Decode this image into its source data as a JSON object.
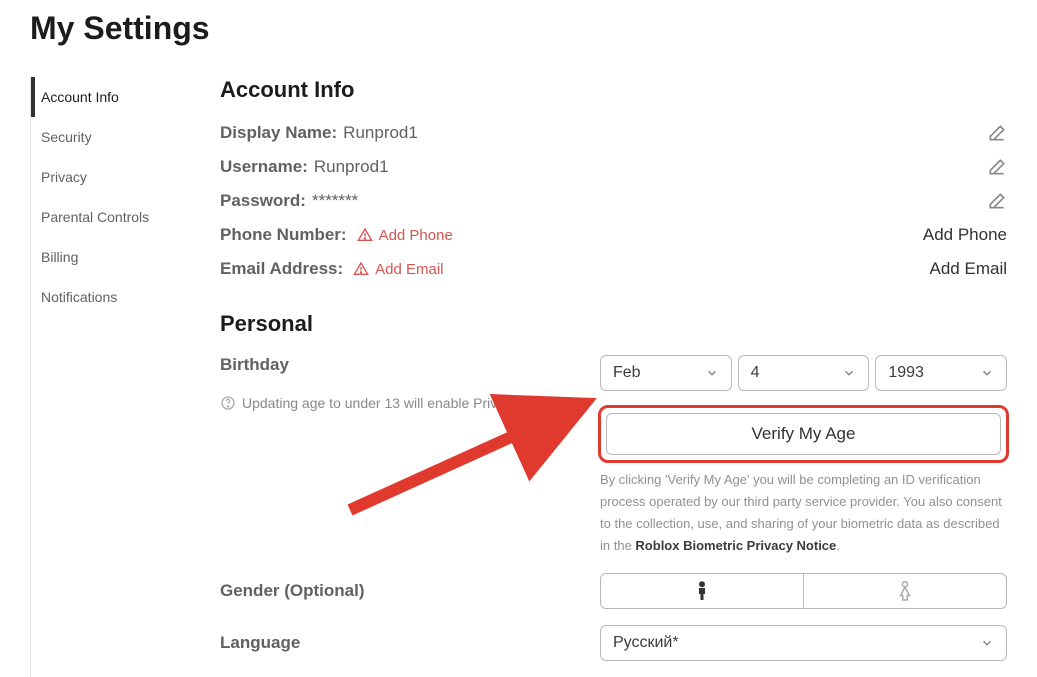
{
  "page_title": "My Settings",
  "sidebar": {
    "items": [
      {
        "label": "Account Info",
        "active": true
      },
      {
        "label": "Security",
        "active": false
      },
      {
        "label": "Privacy",
        "active": false
      },
      {
        "label": "Parental Controls",
        "active": false
      },
      {
        "label": "Billing",
        "active": false
      },
      {
        "label": "Notifications",
        "active": false
      }
    ]
  },
  "account_info": {
    "heading": "Account Info",
    "display_name_label": "Display Name:",
    "display_name_value": "Runprod1",
    "username_label": "Username:",
    "username_value": "Runprod1",
    "password_label": "Password:",
    "password_value": "*******",
    "phone_label": "Phone Number:",
    "phone_add_link": "Add Phone",
    "phone_action": "Add Phone",
    "email_label": "Email Address:",
    "email_add_link": "Add Email",
    "email_action": "Add Email"
  },
  "personal": {
    "heading": "Personal",
    "birthday_label": "Birthday",
    "birthday_month": "Feb",
    "birthday_day": "4",
    "birthday_year": "1993",
    "age_hint": "Updating age to under 13 will enable Privacy Mode.",
    "verify_button": "Verify My Age",
    "disclaimer_pre": "By clicking 'Verify My Age' you will be completing an ID verification process operated by our third party service provider. You also consent to the collection, use, and sharing of your biometric data as described in the ",
    "disclaimer_link": "Roblox Biometric Privacy Notice",
    "disclaimer_post": ".",
    "gender_label": "Gender (Optional)",
    "language_label": "Language",
    "language_value": "Русский*"
  }
}
